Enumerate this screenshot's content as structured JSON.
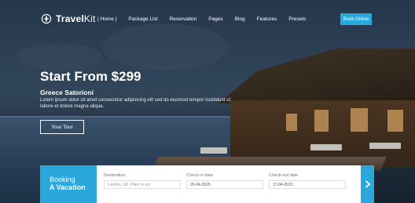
{
  "brand": {
    "name_bold": "Travel",
    "name_light": "Kit"
  },
  "nav": {
    "items": [
      {
        "label": "Home"
      },
      {
        "label": "Package List"
      },
      {
        "label": "Reservation"
      },
      {
        "label": "Pages"
      },
      {
        "label": "Blog"
      },
      {
        "label": "Features"
      },
      {
        "label": "Presets"
      }
    ],
    "book_label": "Book Online"
  },
  "hero": {
    "headline": "Start From $299",
    "subtitle": "Greece Satorioni",
    "description": "Lorem ipsum dolor sit amet consectetur adipisicing elit sed do eiusmod tempor incididunt ut labore et dolore magna aliqua.",
    "cta_label": "Your Tour"
  },
  "booking": {
    "title_line1": "Booking",
    "title_line2": "A Vacation",
    "destination": {
      "label": "Destination",
      "placeholder": "London, UK, Plain or etc"
    },
    "checkin": {
      "label": "Check-in date",
      "value": "26-04-2015"
    },
    "checkout": {
      "label": "Check-out date",
      "value": "17-04-2015"
    }
  },
  "colors": {
    "accent": "#2aa8dc"
  },
  "icons": {
    "logo": "compass-icon",
    "submit": "chevron-right-icon"
  }
}
